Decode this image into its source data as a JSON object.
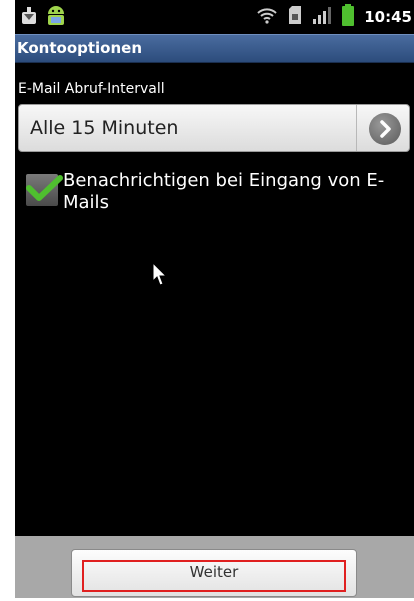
{
  "status_bar": {
    "icons": [
      "download-icon",
      "android-icon",
      "wifi-icon",
      "sd-card-icon",
      "signal-icon",
      "battery-icon"
    ],
    "time": "10:45"
  },
  "header": {
    "title": "Kontooptionen"
  },
  "settings": {
    "interval_label": "E-Mail Abruf-Intervall",
    "interval_value": "Alle 15 Minuten",
    "notify_label": "Benachrichtigen bei Eingang von E-Mails",
    "notify_checked": true
  },
  "footer": {
    "next_label": "Weiter"
  },
  "colors": {
    "titlebar": "#3a5a8c",
    "checkmark": "#4fbf2f",
    "highlight": "#e02020"
  }
}
